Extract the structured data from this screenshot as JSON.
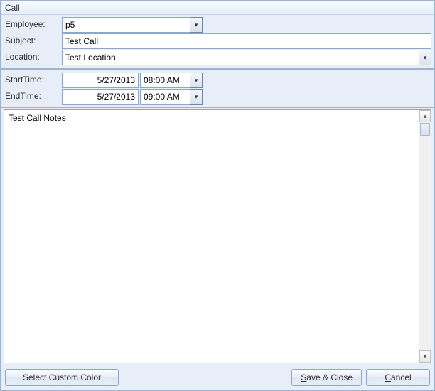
{
  "window": {
    "title": "Call"
  },
  "form": {
    "employee_label": "Employee:",
    "employee_value": "p5",
    "subject_label": "Subject:",
    "subject_value": "Test Call",
    "location_label": "Location:",
    "location_value": "Test Location",
    "start_label": "StartTime:",
    "start_date": "5/27/2013",
    "start_time": "08:00 AM",
    "end_label": "EndTime:",
    "end_date": "5/27/2013",
    "end_time": "09:00 AM"
  },
  "notes": {
    "value": "Test Call Notes"
  },
  "buttons": {
    "select_color": "Select Custom Color",
    "save_close": "Save & Close",
    "cancel": "Cancel"
  },
  "icons": {
    "down": "▾",
    "up": "▴"
  }
}
